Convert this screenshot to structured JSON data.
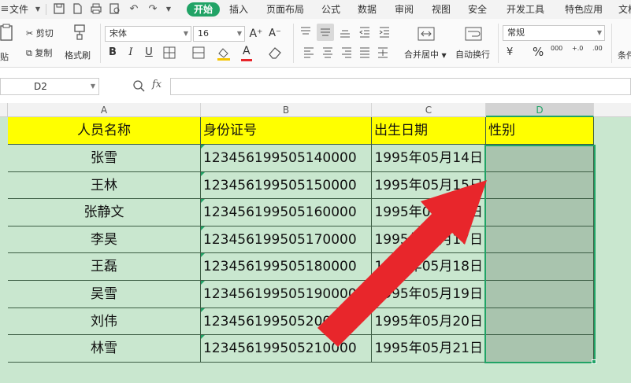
{
  "menubar": {
    "file_label": "文件",
    "tabs": [
      "开始",
      "插入",
      "页面布局",
      "公式",
      "数据",
      "审阅",
      "视图",
      "安全",
      "开发工具",
      "特色应用",
      "文档"
    ]
  },
  "ribbon": {
    "cut": "剪切",
    "copy": "复制",
    "paste_cut": "贴",
    "format_painter": "格式刷",
    "font_name": "宋体",
    "font_size": "16",
    "merge_center": "合并居中",
    "wrap_text": "自动换行",
    "number_format": "常规",
    "percent": "%",
    "thousands": "000",
    "inc_decimal": "+.0",
    "dec_decimal": ".00",
    "conditional": "条件",
    "bold": "B",
    "italic": "I",
    "underline": "U",
    "font_color_letter": "A",
    "grow_font": "A⁺",
    "shrink_font": "A⁻",
    "accent": "#21a366"
  },
  "formula_bar": {
    "cell_ref": "D2",
    "fx": "fx",
    "value": ""
  },
  "columns": [
    "A",
    "B",
    "C",
    "D"
  ],
  "headers": [
    "人员名称",
    "身份证号",
    "出生日期",
    "性别"
  ],
  "rows": [
    [
      "张雪",
      "123456199505140000",
      "1995年05月14日",
      ""
    ],
    [
      "王林",
      "123456199505150000",
      "1995年05月15日",
      ""
    ],
    [
      "张静文",
      "123456199505160000",
      "1995年05月16日",
      ""
    ],
    [
      "李昊",
      "123456199505170000",
      "1995年05月17日",
      ""
    ],
    [
      "王磊",
      "123456199505180000",
      "1995年05月18日",
      ""
    ],
    [
      "吴雪",
      "123456199505190000",
      "1995年05月19日",
      ""
    ],
    [
      "刘伟",
      "123456199505200000",
      "1995年05月20日",
      ""
    ],
    [
      "林雪",
      "123456199505210000",
      "1995年05月21日",
      ""
    ]
  ],
  "colors": {
    "header_fill": "#ffff00",
    "row_fill": "#c9e7cf",
    "selection": "#21a366",
    "selected_fill": "#a9c4ae",
    "arrow": "#e8262b"
  }
}
